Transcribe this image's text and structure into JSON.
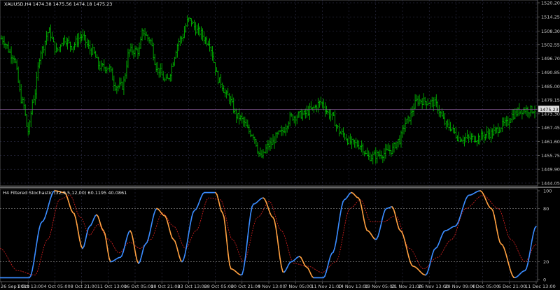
{
  "price_panel": {
    "header": "XAUUSD,H4  1474.38 1475.56 1474.18 1475.23",
    "current_price": "1475.23",
    "price_axis": [
      "1520.20",
      "1514.25",
      "1508.30",
      "1502.55",
      "1496.70",
      "1490.85",
      "1485.00",
      "1479.15",
      "1473.30",
      "1467.45",
      "1461.60",
      "1455.75",
      "1449.90",
      "1444.05"
    ]
  },
  "indicator_panel": {
    "header": "H4 Filtered Stochastic (32,9,5,12,00) 60.1195 40.0861",
    "axis": [
      "100",
      "80",
      "20",
      "0"
    ]
  },
  "time_axis": [
    "26 Sep 2019",
    "1 Oct 13:00",
    "4 Oct 05:00",
    "8 Oct 21:00",
    "11 Oct 13:00",
    "16 Oct 05:00",
    "18 Oct 21:00",
    "23 Oct 13:00",
    "28 Oct 05:00",
    "30 Oct 21:00",
    "4 Nov 13:00",
    "7 Nov 05:00",
    "11 Nov 21:00",
    "14 Nov 13:00",
    "19 Nov 05:00",
    "21 Nov 21:00",
    "26 Nov 13:00",
    "29 Nov 09:00",
    "4 Dec 05:00",
    "6 Dec 21:00",
    "11 Dec 13:00"
  ],
  "colors": {
    "background": "#000000",
    "grid": "#3a3a5a",
    "bar": "#00c800",
    "current_line": "#8a5a9a",
    "stoch_up": "#3a8cff",
    "stoch_down": "#ffa040",
    "signal": "#c81e1e",
    "axis_text": "#c8c8c8"
  },
  "price_data": {
    "bar_count": 380,
    "price_min": 1444.05,
    "price_max": 1520.2,
    "anchors": [
      [
        0,
        1505
      ],
      [
        15,
        1498
      ],
      [
        28,
        1478
      ],
      [
        35,
        1466
      ],
      [
        42,
        1480
      ],
      [
        52,
        1500
      ],
      [
        62,
        1508
      ],
      [
        72,
        1500
      ],
      [
        82,
        1505
      ],
      [
        92,
        1502
      ],
      [
        105,
        1506
      ],
      [
        118,
        1500
      ],
      [
        130,
        1493
      ],
      [
        140,
        1493
      ],
      [
        150,
        1485
      ],
      [
        158,
        1485
      ],
      [
        168,
        1500
      ],
      [
        180,
        1500
      ],
      [
        185,
        1508
      ],
      [
        193,
        1505
      ],
      [
        205,
        1492
      ],
      [
        215,
        1487
      ],
      [
        235,
        1505
      ],
      [
        245,
        1513
      ],
      [
        258,
        1508
      ],
      [
        270,
        1504
      ],
      [
        286,
        1487
      ],
      [
        295,
        1481
      ],
      [
        310,
        1472
      ],
      [
        328,
        1465
      ],
      [
        340,
        1455
      ],
      [
        350,
        1460
      ],
      [
        365,
        1465
      ],
      [
        380,
        1472
      ],
      [
        395,
        1473
      ],
      [
        405,
        1475
      ],
      [
        418,
        1478
      ],
      [
        430,
        1473
      ],
      [
        445,
        1465
      ],
      [
        458,
        1461
      ],
      [
        470,
        1460
      ],
      [
        480,
        1455
      ],
      [
        495,
        1456
      ],
      [
        510,
        1458
      ],
      [
        520,
        1462
      ],
      [
        530,
        1470
      ],
      [
        545,
        1479
      ],
      [
        565,
        1478
      ],
      [
        585,
        1468
      ],
      [
        600,
        1463
      ],
      [
        620,
        1463
      ],
      [
        640,
        1465
      ],
      [
        660,
        1469
      ],
      [
        670,
        1473
      ],
      [
        680,
        1475
      ],
      [
        690,
        1475
      ],
      [
        698,
        1475
      ]
    ]
  },
  "stoch_data": {
    "anchors": [
      [
        0,
        2
      ],
      [
        20,
        2
      ],
      [
        42,
        2
      ],
      [
        60,
        65
      ],
      [
        78,
        100
      ],
      [
        92,
        98
      ],
      [
        105,
        75
      ],
      [
        118,
        35
      ],
      [
        128,
        60
      ],
      [
        138,
        73
      ],
      [
        148,
        55
      ],
      [
        158,
        20
      ],
      [
        172,
        25
      ],
      [
        186,
        55
      ],
      [
        198,
        18
      ],
      [
        208,
        40
      ],
      [
        224,
        80
      ],
      [
        235,
        72
      ],
      [
        248,
        45
      ],
      [
        260,
        20
      ],
      [
        278,
        78
      ],
      [
        292,
        98
      ],
      [
        308,
        98
      ],
      [
        318,
        75
      ],
      [
        330,
        12
      ],
      [
        345,
        5
      ],
      [
        362,
        85
      ],
      [
        376,
        92
      ],
      [
        390,
        70
      ],
      [
        405,
        8
      ],
      [
        416,
        20
      ],
      [
        428,
        26
      ],
      [
        438,
        14
      ],
      [
        448,
        2
      ],
      [
        462,
        2
      ],
      [
        475,
        30
      ],
      [
        492,
        90
      ],
      [
        502,
        98
      ],
      [
        512,
        92
      ],
      [
        525,
        55
      ],
      [
        537,
        45
      ],
      [
        552,
        80
      ],
      [
        560,
        82
      ],
      [
        572,
        55
      ],
      [
        590,
        15
      ],
      [
        608,
        5
      ],
      [
        622,
        35
      ],
      [
        636,
        55
      ],
      [
        650,
        60
      ],
      [
        670,
        95
      ],
      [
        686,
        100
      ],
      [
        702,
        80
      ],
      [
        716,
        40
      ],
      [
        735,
        2
      ],
      [
        750,
        10
      ],
      [
        766,
        60
      ]
    ],
    "signal_anchors": [
      [
        0,
        35
      ],
      [
        25,
        10
      ],
      [
        50,
        5
      ],
      [
        68,
        45
      ],
      [
        85,
        90
      ],
      [
        100,
        95
      ],
      [
        115,
        70
      ],
      [
        128,
        50
      ],
      [
        140,
        62
      ],
      [
        155,
        45
      ],
      [
        170,
        30
      ],
      [
        185,
        42
      ],
      [
        200,
        35
      ],
      [
        215,
        45
      ],
      [
        232,
        75
      ],
      [
        248,
        60
      ],
      [
        265,
        35
      ],
      [
        280,
        55
      ],
      [
        298,
        92
      ],
      [
        315,
        90
      ],
      [
        332,
        45
      ],
      [
        348,
        20
      ],
      [
        368,
        70
      ],
      [
        385,
        88
      ],
      [
        402,
        55
      ],
      [
        420,
        18
      ],
      [
        440,
        15
      ],
      [
        460,
        8
      ],
      [
        480,
        20
      ],
      [
        500,
        80
      ],
      [
        515,
        90
      ],
      [
        530,
        65
      ],
      [
        548,
        65
      ],
      [
        565,
        72
      ],
      [
        585,
        35
      ],
      [
        605,
        12
      ],
      [
        625,
        25
      ],
      [
        645,
        45
      ],
      [
        665,
        80
      ],
      [
        690,
        95
      ],
      [
        712,
        80
      ],
      [
        730,
        45
      ],
      [
        750,
        20
      ],
      [
        766,
        40
      ]
    ]
  }
}
